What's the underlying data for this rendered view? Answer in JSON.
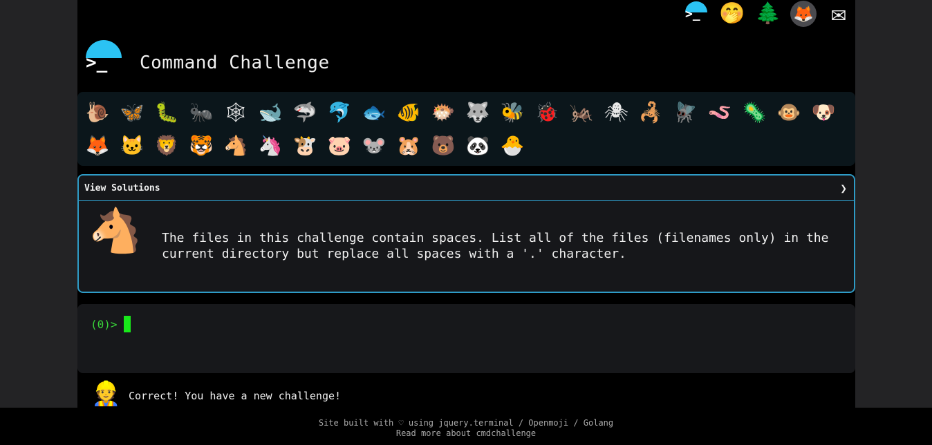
{
  "header": {
    "title": "Command Challenge",
    "logo_glyph": ">_"
  },
  "top_icons": [
    {
      "name": "cmdchallenge-logo-icon",
      "glyph": ">_"
    },
    {
      "name": "hand-over-mouth-icon",
      "glyph": "🤭"
    },
    {
      "name": "evergreen-tree-icon",
      "glyph": "🌲"
    },
    {
      "name": "gitlab-icon",
      "glyph": "🦊"
    },
    {
      "name": "envelope-icon",
      "glyph": "✉"
    }
  ],
  "animals": [
    {
      "name": "snail",
      "glyph": "🐌"
    },
    {
      "name": "butterfly",
      "glyph": "🦋"
    },
    {
      "name": "caterpillar",
      "glyph": "🐛"
    },
    {
      "name": "ant",
      "glyph": "🐜"
    },
    {
      "name": "spider-web",
      "glyph": "🕸"
    },
    {
      "name": "whale",
      "glyph": "🐋"
    },
    {
      "name": "shark",
      "glyph": "🦈"
    },
    {
      "name": "dolphin",
      "glyph": "🐬"
    },
    {
      "name": "fish",
      "glyph": "🐟"
    },
    {
      "name": "tropical-fish",
      "glyph": "🐠"
    },
    {
      "name": "blowfish",
      "glyph": "🐡"
    },
    {
      "name": "wolf",
      "glyph": "🐺"
    },
    {
      "name": "bee",
      "glyph": "🐝"
    },
    {
      "name": "ladybug",
      "glyph": "🐞"
    },
    {
      "name": "cricket",
      "glyph": "🦗"
    },
    {
      "name": "spider",
      "glyph": "🕷"
    },
    {
      "name": "scorpion",
      "glyph": "🦂"
    },
    {
      "name": "fly",
      "glyph": "🪰"
    },
    {
      "name": "worm",
      "glyph": "🪱"
    },
    {
      "name": "microbe",
      "glyph": "🦠"
    },
    {
      "name": "monkey",
      "glyph": "🐵"
    },
    {
      "name": "dog",
      "glyph": "🐶"
    },
    {
      "name": "fox",
      "glyph": "🦊"
    },
    {
      "name": "cat",
      "glyph": "🐱"
    },
    {
      "name": "lion",
      "glyph": "🦁"
    },
    {
      "name": "tiger",
      "glyph": "🐯"
    },
    {
      "name": "horse",
      "glyph": "🐴"
    },
    {
      "name": "unicorn",
      "glyph": "🦄"
    },
    {
      "name": "cow",
      "glyph": "🐮"
    },
    {
      "name": "pig",
      "glyph": "🐷"
    },
    {
      "name": "mouse",
      "glyph": "🐭"
    },
    {
      "name": "hamster",
      "glyph": "🐹"
    },
    {
      "name": "bear",
      "glyph": "🐻"
    },
    {
      "name": "panda",
      "glyph": "🐼"
    },
    {
      "name": "hatching-chick",
      "glyph": "🐣"
    }
  ],
  "solutions": {
    "label": "View Solutions",
    "chevron": "❯",
    "mascot_glyph": "🐴",
    "challenge_text": "The files in this challenge contain spaces. List all of the files (filenames only) in the current directory but replace all spaces with a '.' character."
  },
  "terminal": {
    "prompt": "(0)>"
  },
  "message": {
    "icon_glyph": "👷",
    "text": "Correct! You have a new challenge!"
  },
  "footer": {
    "line1": "Site built with ♡ using jquery.terminal / Openmoji / Golang",
    "line2": "Read more about cmdchallenge"
  }
}
